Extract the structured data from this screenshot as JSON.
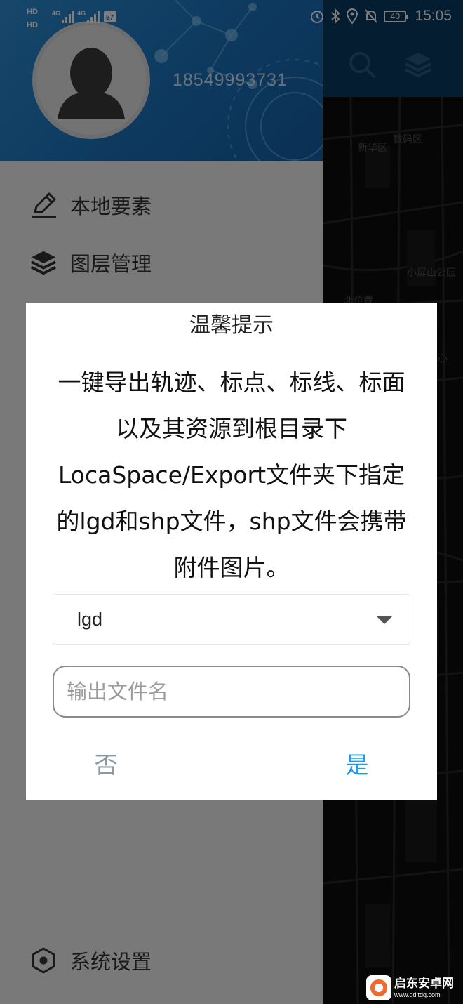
{
  "status_bar": {
    "left_badges": [
      "HD",
      "HD"
    ],
    "network_1": "4G",
    "network_2": "4G",
    "battery": "40",
    "time": "15:05"
  },
  "drawer": {
    "phone": "18549993731",
    "menu": [
      {
        "label": "本地要素",
        "icon": "pencil-icon"
      },
      {
        "label": "图层管理",
        "icon": "layers-icon"
      }
    ],
    "settings": {
      "label": "系统设置",
      "icon": "hexagon-settings-icon"
    }
  },
  "map": {
    "labels": [
      "新华区",
      "数码区",
      "小屏山公园",
      "北位置",
      "中心"
    ]
  },
  "dialog": {
    "title": "温馨提示",
    "message": "一键导出轨迹、标点、标线、标面以及其资源到根目录下LocaSpace/Export文件夹下指定的lgd和shp文件，shp文件会携带附件图片。",
    "format_value": "lgd",
    "filename_placeholder": "输出文件名",
    "no_label": "否",
    "yes_label": "是"
  },
  "watermark": {
    "name": "启东安卓网",
    "url": "www.qdltdq.com"
  },
  "colors": {
    "header_blue": "#1d78c4",
    "map_toolbar": "#0b3b61",
    "confirm_blue": "#1f9ee8",
    "cancel_gray": "#8b98a3"
  }
}
